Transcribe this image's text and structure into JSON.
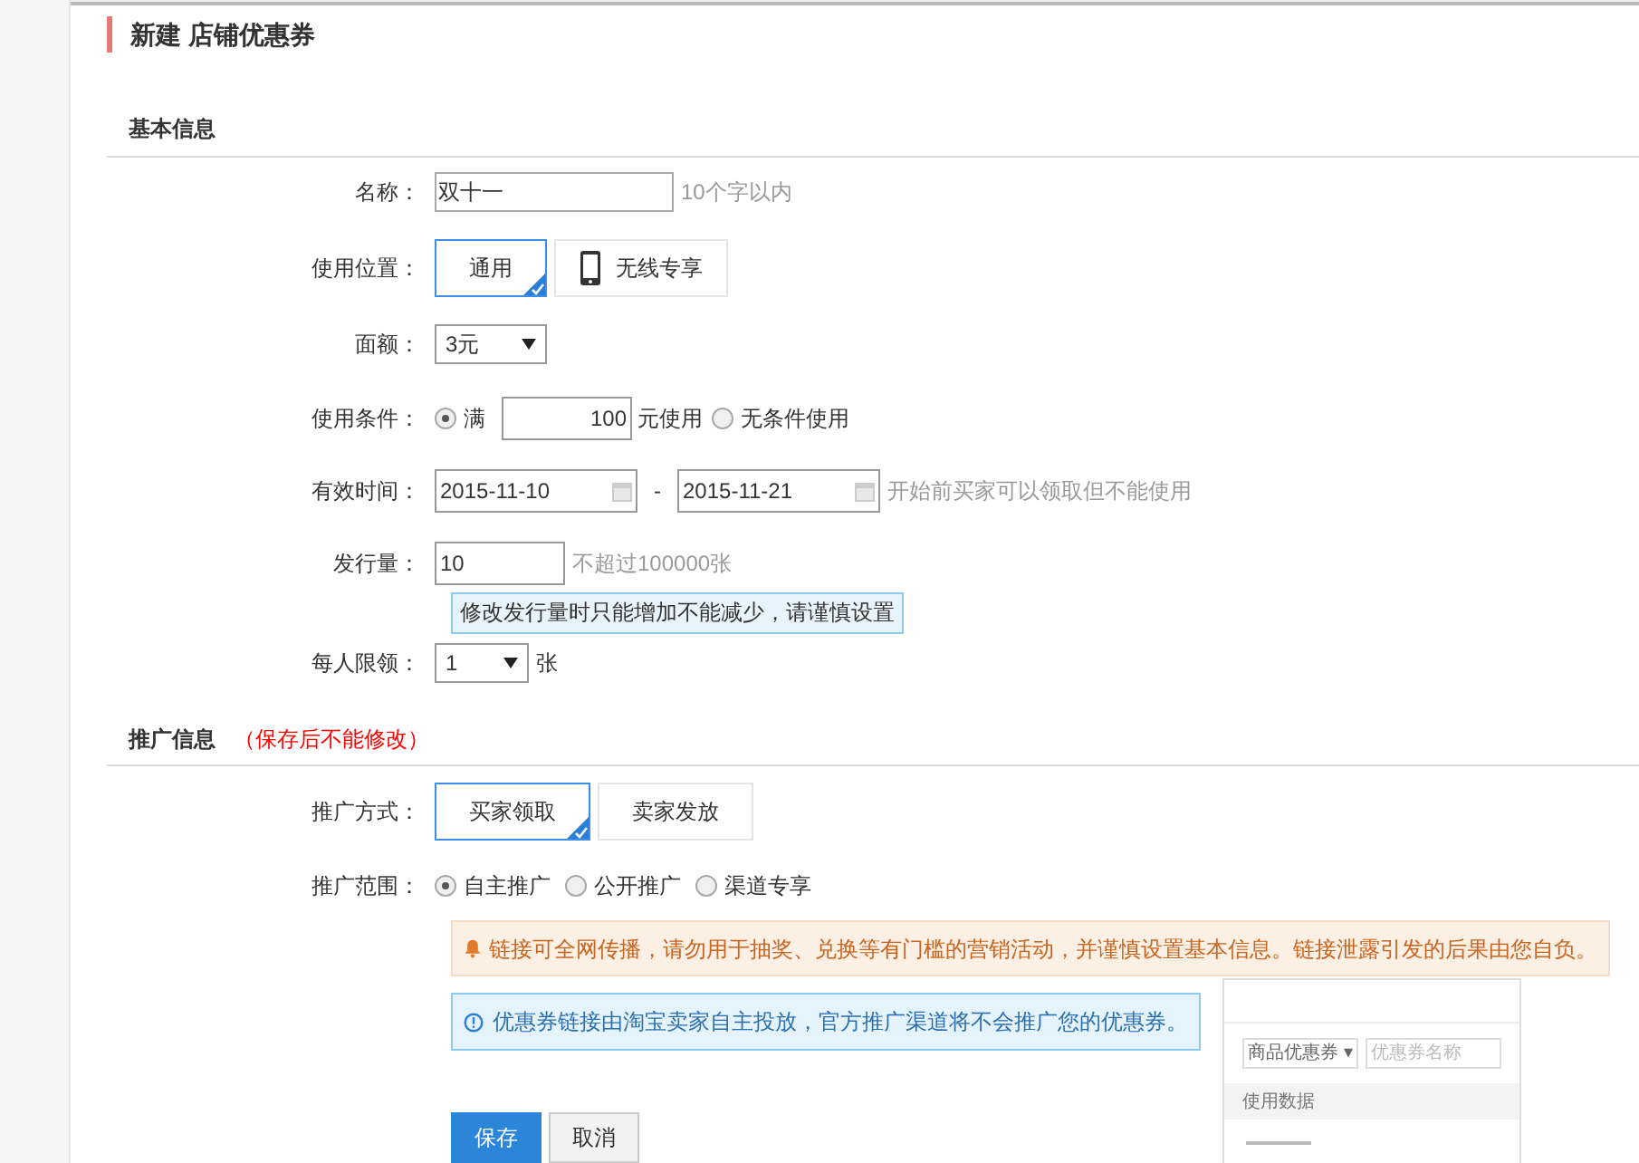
{
  "page_title": "新建 店铺优惠券",
  "basic_info": {
    "heading": "基本信息",
    "name": {
      "label": "名称：",
      "value": "双十一",
      "hint": "10个字以内"
    },
    "usage_location": {
      "label": "使用位置：",
      "options": [
        {
          "label": "通用",
          "selected": true,
          "kind": "text"
        },
        {
          "label": "无线专享",
          "selected": false,
          "kind": "phone"
        }
      ]
    },
    "face_value": {
      "label": "面额：",
      "value": "3元"
    },
    "condition": {
      "label": "使用条件：",
      "options": [
        {
          "label": "满",
          "selected": true,
          "kind": "amount",
          "amount": "100",
          "suffix": "元使用"
        },
        {
          "label": "无条件使用",
          "selected": false,
          "kind": "plain"
        }
      ]
    },
    "validity": {
      "label": "有效时间：",
      "start": "2015-11-10",
      "separator": "-",
      "end": "2015-11-21",
      "hint": "开始前买家可以领取但不能使用"
    },
    "quantity": {
      "label": "发行量：",
      "value": "10",
      "hint": "不超过100000张",
      "notice": "修改发行量时只能增加不能减少，请谨慎设置"
    },
    "limit": {
      "label": "每人限领：",
      "value": "1",
      "unit": "张"
    }
  },
  "promotion_info": {
    "heading": "推广信息",
    "note": "（保存后不能修改）",
    "method": {
      "label": "推广方式：",
      "options": [
        {
          "label": "买家领取",
          "selected": true
        },
        {
          "label": "卖家发放",
          "selected": false
        }
      ]
    },
    "scope": {
      "label": "推广范围：",
      "options": [
        {
          "label": "自主推广",
          "selected": true
        },
        {
          "label": "公开推广",
          "selected": false
        },
        {
          "label": "渠道专享",
          "selected": false
        }
      ]
    },
    "warning": "链接可全网传播，请勿用于抽奖、兑换等有门槛的营销活动，并谨慎设置基本信息。链接泄露引发的后果由您自负。",
    "info": "优惠券链接由淘宝卖家自主投放，官方推广渠道将不会推广您的优惠券。",
    "preview": {
      "dropdown": "商品优惠券 ▾",
      "search_placeholder": "优惠券名称",
      "column": "使用数据"
    }
  },
  "buttons": [
    {
      "label": "保存",
      "kind": "primary"
    },
    {
      "label": "取消",
      "kind": "secondary"
    }
  ]
}
